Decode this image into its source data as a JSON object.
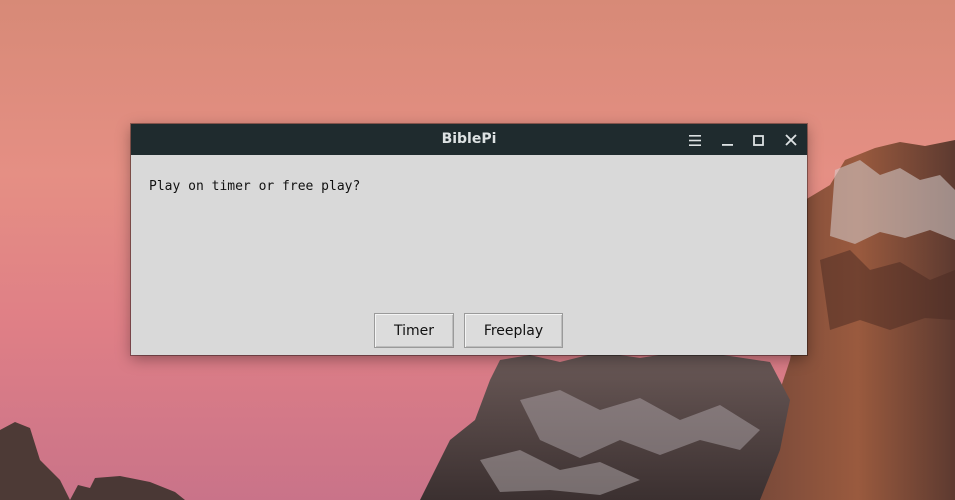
{
  "window": {
    "title": "BiblePi",
    "controls": {
      "menu_icon": "hamburger-menu-icon",
      "minimize_icon": "minimize-icon",
      "maximize_icon": "maximize-icon",
      "close_icon": "close-icon"
    }
  },
  "dialog": {
    "prompt": "Play on timer or free play?",
    "buttons": {
      "timer_label": "Timer",
      "freeplay_label": "Freeplay"
    }
  },
  "colors": {
    "titlebar": "#1f2b2e",
    "window_body": "#d9d9d9",
    "sky": "#e58f84"
  }
}
